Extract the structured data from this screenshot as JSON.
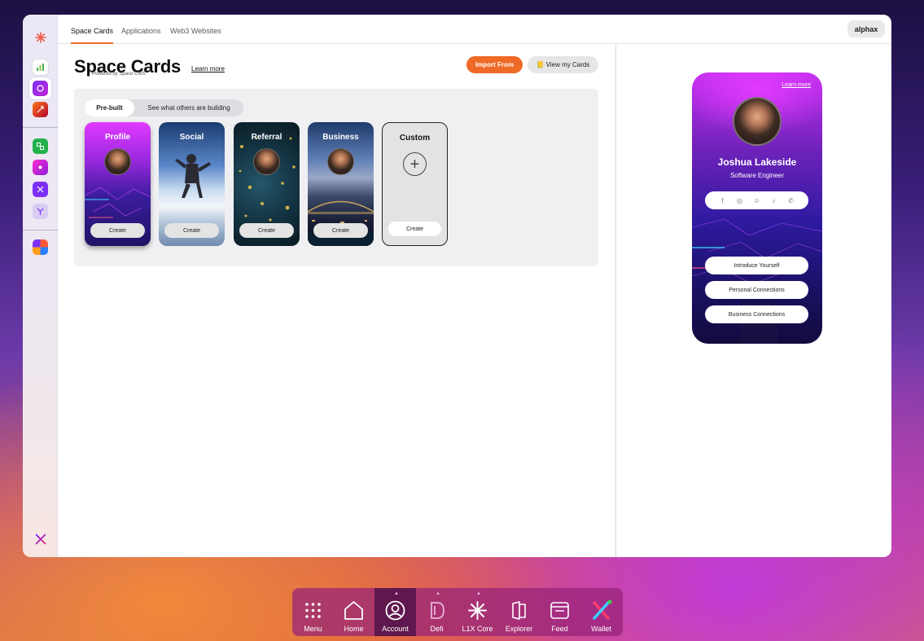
{
  "tabs": [
    "Space Cards",
    "Applications",
    "Web3 Websites"
  ],
  "user": "alphax",
  "page": {
    "title": "Space Cards",
    "powered_by": "Powered by Space CMS",
    "learn_more": "Learn more",
    "import_button": "Import From",
    "view_cards_button": "View my Cards",
    "view_cards_icon": "📒"
  },
  "segments": [
    "Pre-built",
    "See what others are building"
  ],
  "cards": [
    {
      "title": "Profile",
      "create": "Create"
    },
    {
      "title": "Social",
      "create": "Create"
    },
    {
      "title": "Referral",
      "create": "Create"
    },
    {
      "title": "Business",
      "create": "Create"
    },
    {
      "title": "Custom",
      "create": "Create",
      "plus": "+"
    }
  ],
  "preview": {
    "learn_more": "Learn more",
    "name": "Joshua Lakeside",
    "role": "Software Engineer",
    "social_icons": [
      "facebook-icon",
      "instagram-icon",
      "snapchat-icon",
      "tiktok-icon",
      "whatsapp-icon"
    ],
    "social_glyphs": [
      "f",
      "◎",
      "☺",
      "♪",
      "✆"
    ],
    "buttons": [
      "Introduce Yourself",
      "Personal Connections",
      "Business Connections"
    ]
  },
  "dock": [
    "Menu",
    "Home",
    "Account",
    "Defi",
    "L1X Core",
    "Explorer",
    "Feed",
    "Wallet"
  ],
  "colors": {
    "accent": "#ef6a26",
    "dock": "#96237a"
  }
}
